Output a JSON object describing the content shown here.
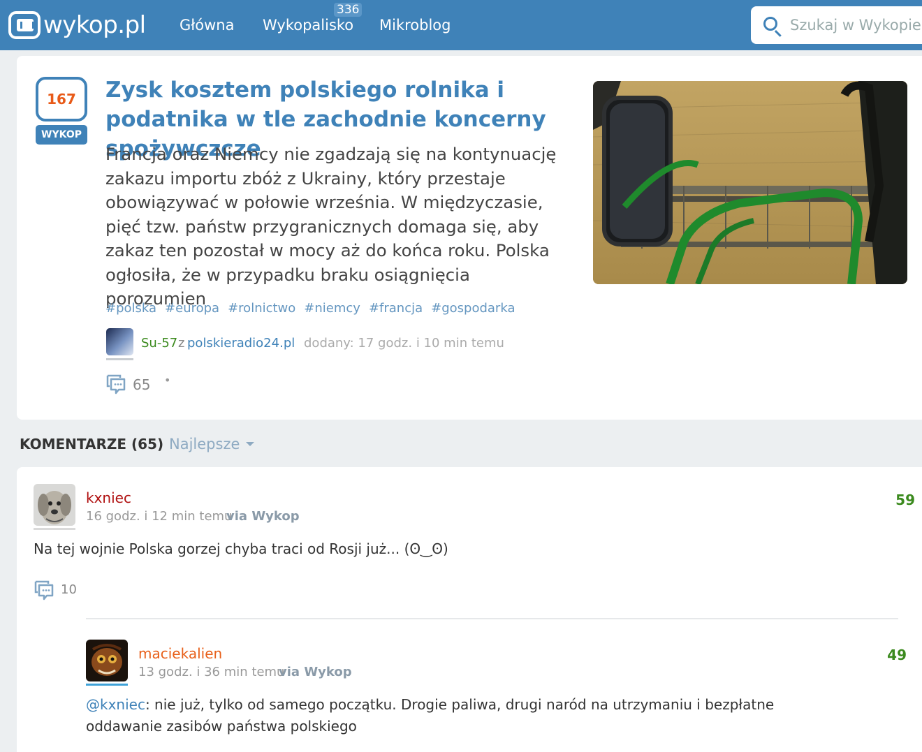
{
  "header": {
    "logo_text": "wykop.pl",
    "nav": {
      "main": "Główna",
      "wykopalisko": "Wykopalisko",
      "wykopalisko_badge": "336",
      "mikroblog": "Mikroblog"
    },
    "search_placeholder": "Szukaj w Wykopie..."
  },
  "article": {
    "votes": "167",
    "vote_button": "WYKOP",
    "title": "Zysk kosztem polskiego rolnika i podatnika w tle zachodnie koncerny spożywczcze",
    "description": "Francja oraz Niemcy nie zgadzają się na kontynuację zakazu importu zbóż z Ukrainy, który przestaje obowiązywać w połowie września. W międzyczasie, pięć tzw. państw przygranicznych domaga się, aby zakaz ten pozostał w mocy aż do końca roku. Polska ogłosiła, że w przypadku braku osiągnięcia porozumien",
    "tags": [
      "#polska",
      "#europa",
      "#rolnictwo",
      "#niemcy",
      "#francja",
      "#gospodarka"
    ],
    "author": "Su-57",
    "from_word": "z",
    "source": "polskieradio24.pl",
    "added": "dodany: 17 godz. i 10 min temu",
    "comments_count": "65",
    "dot": "•"
  },
  "comments_section": {
    "title": "KOMENTARZE (65)",
    "sort": "Najlepsze"
  },
  "comments": [
    {
      "author": "kxniec",
      "time": "16 godz. i 12 min temu",
      "via": "via Wykop",
      "votes": "59",
      "body": "Na tej wojnie Polska gorzej chyba traci od Rosji już... (ʘ‿ʘ)",
      "replies": "10",
      "author_color": "#b01010"
    },
    {
      "author": "maciekalien",
      "time": "13 godz. i 36 min temu",
      "via": "via Wykop",
      "votes": "49",
      "mention": "@kxniec",
      "body": ": nie już, tylko od samego początku. Drogie paliwa, drugi naród na utrzymaniu i bezpłatne oddawanie zasibów państwa polskiego",
      "author_color": "#e8601a"
    }
  ]
}
